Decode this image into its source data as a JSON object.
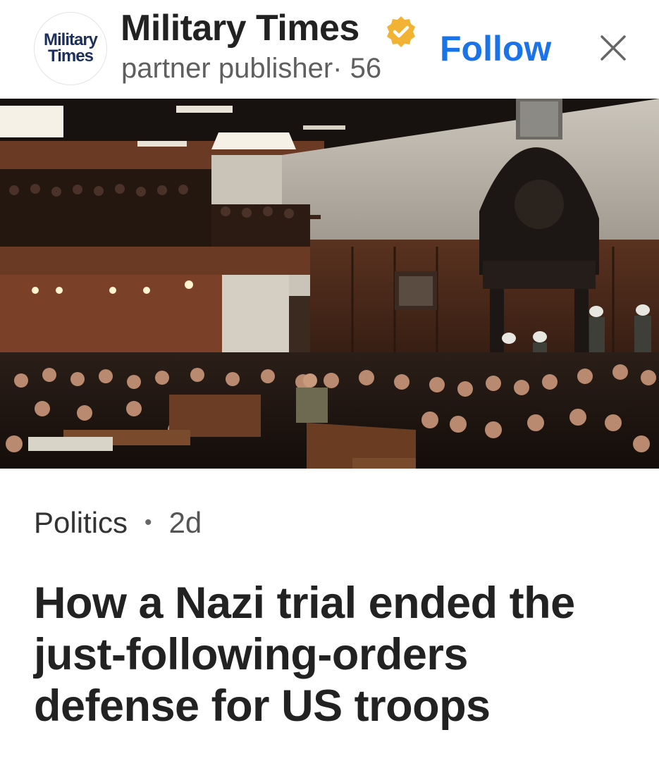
{
  "header": {
    "logo_line1": "Military",
    "logo_line2": "Times",
    "publisher_name": "Military Times",
    "publisher_meta": "partner publisher· 56",
    "follow_label": "Follow",
    "verified_icon": "verified-badge-icon",
    "close_icon": "close-icon"
  },
  "hero": {
    "image_icon": "courtroom-photo"
  },
  "article": {
    "category": "Politics",
    "separator": "•",
    "age": "2d",
    "headline": "How a Nazi trial ended the just-following-orders defense for US troops"
  },
  "colors": {
    "accent": "#1a73e8",
    "verified": "#f2b233",
    "text": "#222222",
    "muted": "#5f5f5f"
  }
}
